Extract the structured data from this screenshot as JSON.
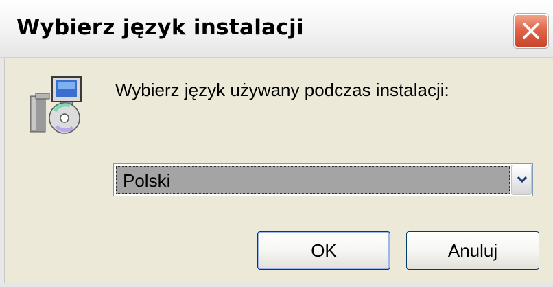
{
  "window": {
    "title": "Wybierz język instalacji"
  },
  "dialog": {
    "prompt": "Wybierz język używany podczas instalacji:",
    "icon": "installer-icon"
  },
  "language_select": {
    "selected": "Polski"
  },
  "buttons": {
    "ok_label": "OK",
    "cancel_label": "Anuluj"
  },
  "colors": {
    "window_background": "#ece9d8",
    "close_button": "#e2654a",
    "selection_highlight": "#a4a4a4",
    "button_border": "#003c74"
  }
}
